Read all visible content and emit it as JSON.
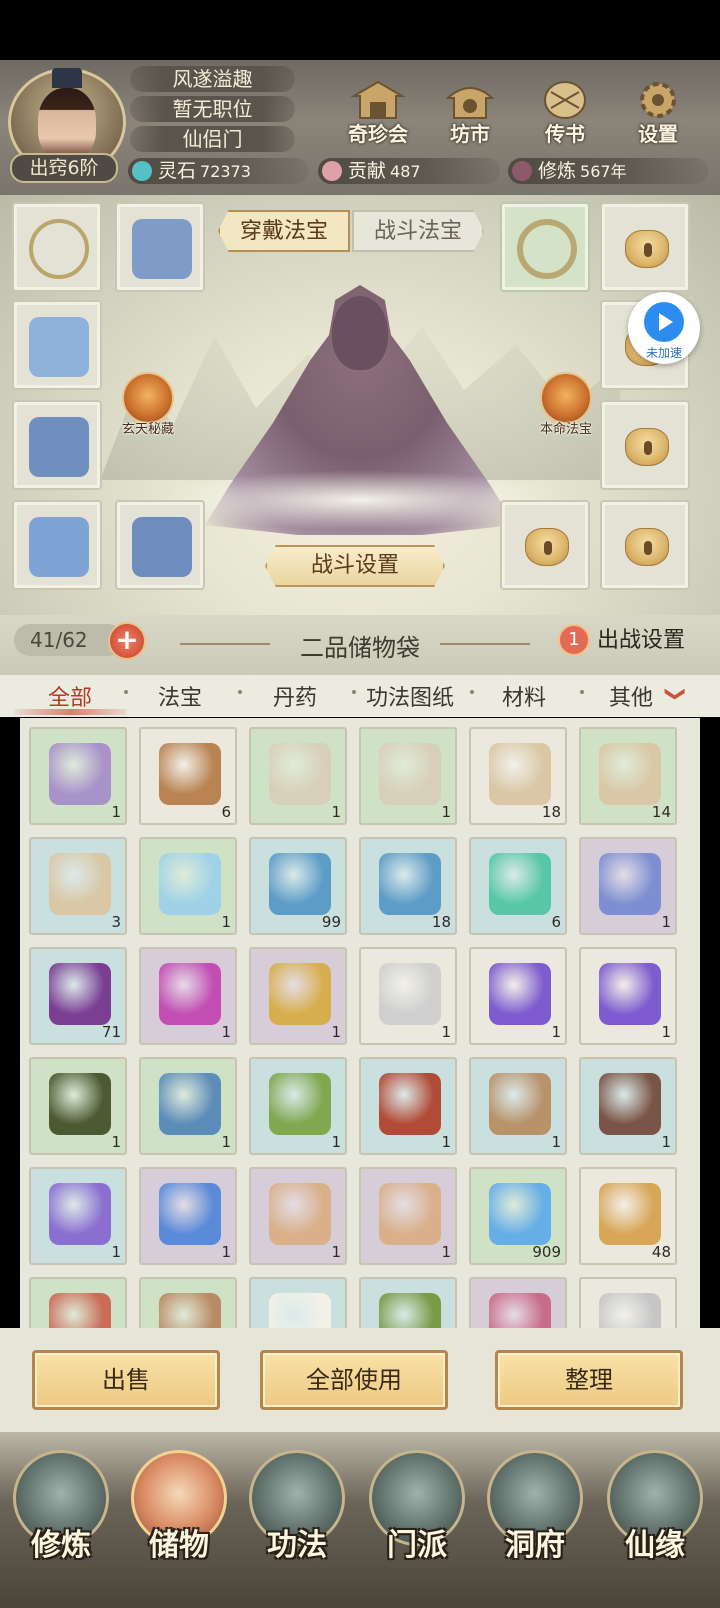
{
  "header": {
    "name_title": "风遂溢趣",
    "job": "暂无职位",
    "sect": "仙侣门",
    "realm": "出窍6阶",
    "top_buttons": [
      {
        "label": "奇珍会",
        "icon": "treasure-pavilion-icon"
      },
      {
        "label": "坊市",
        "icon": "market-icon"
      },
      {
        "label": "传书",
        "icon": "scroll-letter-icon"
      },
      {
        "label": "设置",
        "icon": "gear-icon"
      }
    ],
    "resources": [
      {
        "label": "灵石",
        "value": "72373",
        "icon": "spirit-stone-icon"
      },
      {
        "label": "贡献",
        "value": "487",
        "icon": "contribution-icon"
      },
      {
        "label": "修炼",
        "value": "567年",
        "icon": "cultivation-icon"
      }
    ]
  },
  "equip": {
    "tab_wear": "穿戴法宝",
    "tab_battle": "战斗法宝",
    "left_circle_label": "玄天秘藏",
    "right_circle_label": "本命法宝",
    "fight_settings": "战斗设置",
    "speed_label": "未加速"
  },
  "bag": {
    "capacity": "41/62",
    "plus": "+",
    "title": "二品储物袋",
    "deploy_count": "1",
    "deploy_label": "出战设置",
    "categories": [
      "全部",
      "法宝",
      "丹药",
      "功法图纸",
      "材料",
      "其他"
    ],
    "more": "❯",
    "items": [
      {
        "icon": "orb-on-cloth",
        "count": "1",
        "bg": "g",
        "color": "#a893c9"
      },
      {
        "icon": "bronze-orb",
        "count": "6",
        "bg": "w",
        "color": "#b98452"
      },
      {
        "icon": "open-book",
        "count": "1",
        "bg": "g",
        "color": "#d8cfb8"
      },
      {
        "icon": "open-book",
        "count": "1",
        "bg": "g",
        "color": "#d8cfb8"
      },
      {
        "icon": "paper-scroll",
        "count": "18",
        "bg": "w",
        "color": "#d9c7a5"
      },
      {
        "icon": "paper-scroll",
        "count": "14",
        "bg": "g",
        "color": "#d9c7a5"
      },
      {
        "icon": "paper-scroll",
        "count": "3",
        "bg": "b",
        "color": "#d9c7a5"
      },
      {
        "icon": "porcelain-vase",
        "count": "1",
        "bg": "g",
        "color": "#9fd2e6"
      },
      {
        "icon": "blue-herb",
        "count": "99",
        "bg": "b",
        "color": "#5d9cc7"
      },
      {
        "icon": "blue-herb",
        "count": "18",
        "bg": "b",
        "color": "#5d9cc7"
      },
      {
        "icon": "jade-lotus-leaf",
        "count": "6",
        "bg": "b",
        "color": "#58c7a6"
      },
      {
        "icon": "violet-herb",
        "count": "1",
        "bg": "p",
        "color": "#7e8fd1"
      },
      {
        "icon": "purple-grass",
        "count": "71",
        "bg": "b",
        "color": "#7a3f93"
      },
      {
        "icon": "purple-grass",
        "count": "1",
        "bg": "p",
        "color": "#c24db3"
      },
      {
        "icon": "golden-grass",
        "count": "1",
        "bg": "p",
        "color": "#d7ae4e"
      },
      {
        "icon": "sword",
        "count": "1",
        "bg": "w",
        "color": "#cfcfcf"
      },
      {
        "icon": "purple-talisman",
        "count": "1",
        "bg": "w",
        "color": "#7e5ccf"
      },
      {
        "icon": "purple-talisman",
        "count": "1",
        "bg": "w",
        "color": "#7e5ccf"
      },
      {
        "icon": "whip",
        "count": "1",
        "bg": "g",
        "color": "#4b5a32"
      },
      {
        "icon": "hammer",
        "count": "1",
        "bg": "g",
        "color": "#5c8cb8"
      },
      {
        "icon": "green-shell",
        "count": "1",
        "bg": "b",
        "color": "#7fa84f"
      },
      {
        "icon": "red-orb",
        "count": "1",
        "bg": "b",
        "color": "#b14a36"
      },
      {
        "icon": "banner",
        "count": "1",
        "bg": "b",
        "color": "#b8926b"
      },
      {
        "icon": "brown-orb",
        "count": "1",
        "bg": "b",
        "color": "#7a5446"
      },
      {
        "icon": "spear",
        "count": "1",
        "bg": "b",
        "color": "#8a6fd0"
      },
      {
        "icon": "axe",
        "count": "1",
        "bg": "p",
        "color": "#5a8ad8"
      },
      {
        "icon": "saber",
        "count": "1",
        "bg": "p",
        "color": "#d9b08a"
      },
      {
        "icon": "saber",
        "count": "1",
        "bg": "p",
        "color": "#d9b08a"
      },
      {
        "icon": "water-drop",
        "count": "909",
        "bg": "g",
        "color": "#66aee6"
      },
      {
        "icon": "ginseng-root",
        "count": "48",
        "bg": "w",
        "color": "#d8a657"
      },
      {
        "icon": "red-fruit",
        "count": "",
        "bg": "g",
        "color": "#c96b55"
      },
      {
        "icon": "gourd",
        "count": "",
        "bg": "g",
        "color": "#b98b64"
      },
      {
        "icon": "white-flower",
        "count": "",
        "bg": "b",
        "color": "#f2f1e8"
      },
      {
        "icon": "spiky-fruit",
        "count": "",
        "bg": "b",
        "color": "#7a9a45"
      },
      {
        "icon": "berry-branch",
        "count": "",
        "bg": "p",
        "color": "#c96b8a"
      },
      {
        "icon": "crystal",
        "count": "",
        "bg": "w",
        "color": "#c6c6c6"
      }
    ]
  },
  "actions": {
    "sell": "出售",
    "use_all": "全部使用",
    "sort": "整理"
  },
  "nav": [
    {
      "label": "修炼",
      "active": false
    },
    {
      "label": "储物",
      "active": true
    },
    {
      "label": "功法",
      "active": false
    },
    {
      "label": "门派",
      "active": false
    },
    {
      "label": "洞府",
      "active": false
    },
    {
      "label": "仙缘",
      "active": false
    }
  ],
  "colors": {
    "accent": "#b33a2a",
    "gold": "#eec982",
    "panel": "#e8e7dc"
  }
}
